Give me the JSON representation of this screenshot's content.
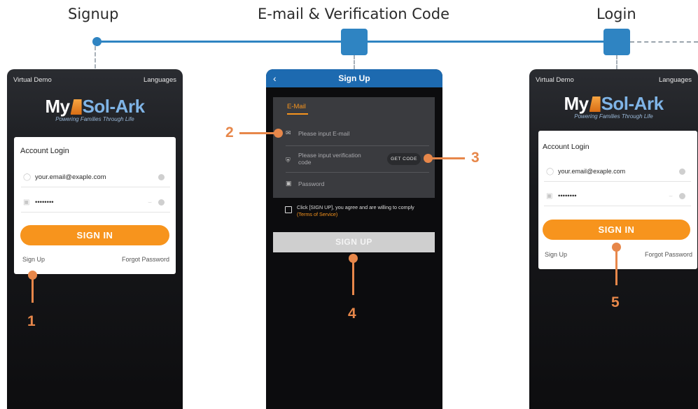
{
  "steps": {
    "signup": "Signup",
    "email": "E-mail & Verification Code",
    "login": "Login"
  },
  "colors": {
    "timeline": "#2f84c2",
    "accent": "#f7941d",
    "callout": "#e7874a",
    "header_blue": "#1d6ab0"
  },
  "login_screen": {
    "virtual_demo": "Virtual Demo",
    "languages": "Languages",
    "logo_my": "My",
    "logo_brand": "Sol-Ark",
    "logo_tagline": "Powering Families Through Life",
    "card_title": "Account Login",
    "email_value": "your.email@exaple.com",
    "password_value": "••••••••",
    "sign_in": "SIGN IN",
    "sign_up_link": "Sign Up",
    "forgot_link": "Forgot Password",
    "icons": {
      "user": "user-icon",
      "lock": "lock-icon",
      "clear": "clear-icon",
      "eye": "eye-hidden-icon"
    }
  },
  "signup_screen": {
    "back": "‹",
    "title": "Sign Up",
    "tab": "E-Mail",
    "email_placeholder": "Please input E-mail",
    "code_placeholder_1": "Please input verification",
    "code_placeholder_2": "code",
    "get_code": "GET CODE",
    "password_placeholder": "Password",
    "agree_text": "Click [SIGN UP], you agree and are willing to comply",
    "terms": "(Terms of Service)",
    "sign_up_button": "SIGN UP",
    "icons": {
      "mail": "mail-icon",
      "shield": "shield-icon",
      "lock": "lock-icon",
      "back": "back-arrow-icon",
      "checkbox": "checkbox"
    }
  },
  "callouts": {
    "n1": "1",
    "n2": "2",
    "n3": "3",
    "n4": "4",
    "n5": "5"
  }
}
